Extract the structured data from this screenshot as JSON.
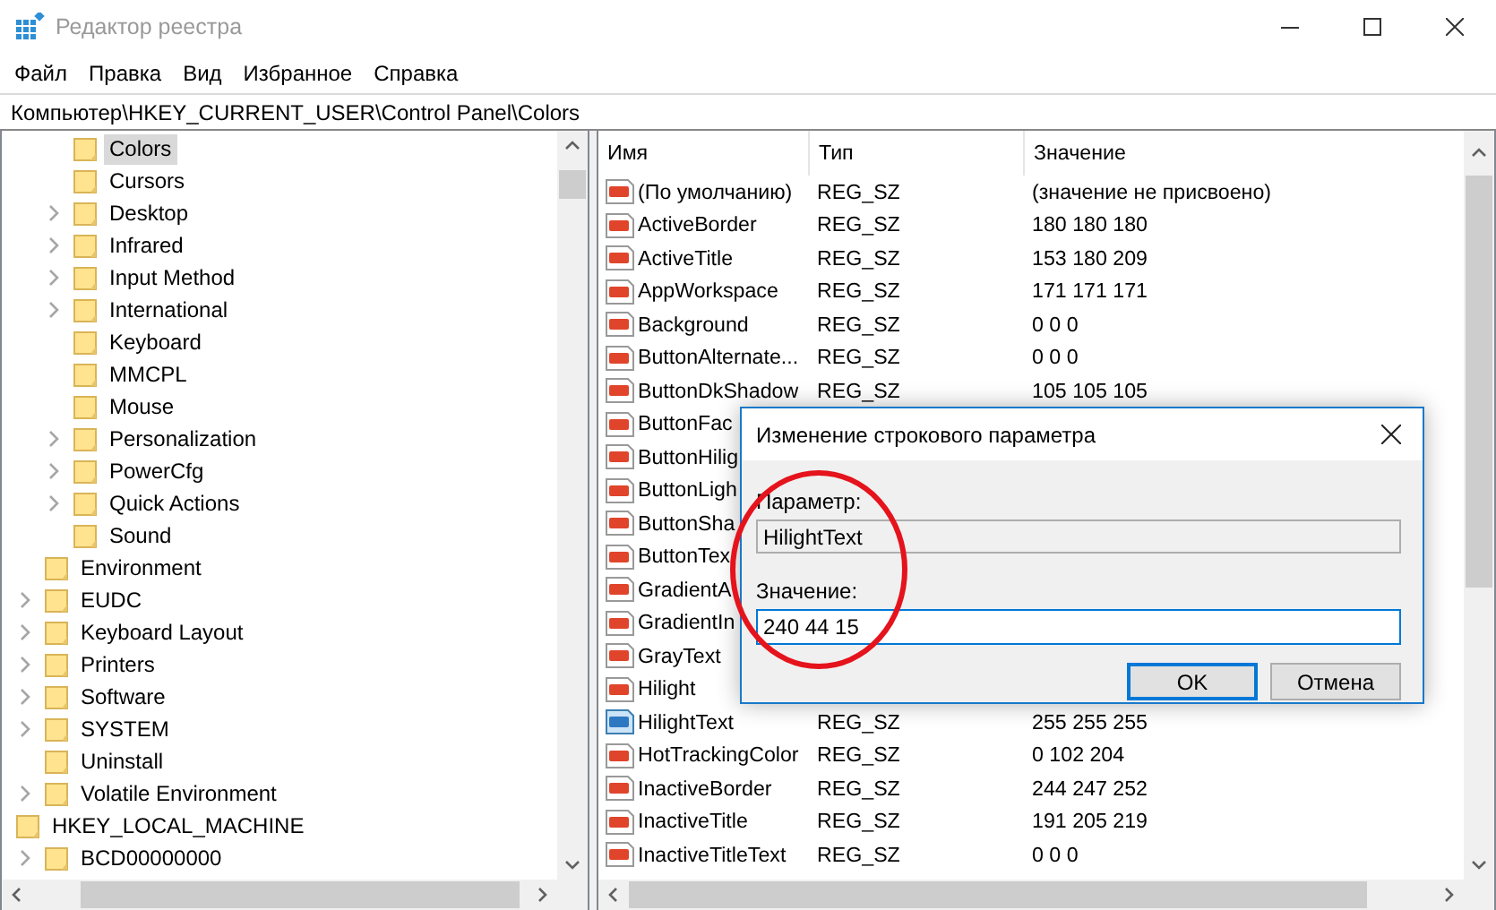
{
  "window": {
    "title": "Редактор реестра"
  },
  "menu": [
    "Файл",
    "Правка",
    "Вид",
    "Избранное",
    "Справка"
  ],
  "address": "Компьютер\\HKEY_CURRENT_USER\\Control Panel\\Colors",
  "tree": [
    {
      "children": [
        {
          "children": [
            {
              "label": "Colors",
              "arrow": false,
              "selected": true
            },
            {
              "label": "Cursors",
              "arrow": false,
              "selected": false
            },
            {
              "label": "Desktop",
              "arrow": true,
              "selected": false
            },
            {
              "label": "Infrared",
              "arrow": true,
              "selected": false
            },
            {
              "label": "Input Method",
              "arrow": true,
              "selected": false
            },
            {
              "label": "International",
              "arrow": true,
              "selected": false
            },
            {
              "label": "Keyboard",
              "arrow": false,
              "selected": false
            },
            {
              "label": "MMCPL",
              "arrow": false,
              "selected": false
            },
            {
              "label": "Mouse",
              "arrow": false,
              "selected": false
            },
            {
              "label": "Personalization",
              "arrow": true,
              "selected": false
            },
            {
              "label": "PowerCfg",
              "arrow": true,
              "selected": false
            },
            {
              "label": "Quick Actions",
              "arrow": true,
              "selected": false
            },
            {
              "label": "Sound",
              "arrow": false,
              "selected": false
            }
          ]
        },
        {
          "label": "Environment",
          "arrow": false,
          "selected": false
        },
        {
          "label": "EUDC",
          "arrow": true,
          "selected": false
        },
        {
          "label": "Keyboard Layout",
          "arrow": true,
          "selected": false
        },
        {
          "label": "Printers",
          "arrow": true,
          "selected": false
        },
        {
          "label": "Software",
          "arrow": true,
          "selected": false
        },
        {
          "label": "SYSTEM",
          "arrow": true,
          "selected": false
        },
        {
          "label": "Uninstall",
          "arrow": false,
          "selected": false
        },
        {
          "label": "Volatile Environment",
          "arrow": true,
          "selected": false
        }
      ]
    },
    {
      "label": "HKEY_LOCAL_MACHINE",
      "arrow": false,
      "selected": false,
      "children": [
        {
          "label": "BCD00000000",
          "arrow": true,
          "selected": false
        }
      ]
    }
  ],
  "values": {
    "columns": [
      "Имя",
      "Тип",
      "Значение"
    ],
    "rows": [
      {
        "name": "(По умолчанию)",
        "type": "REG_SZ",
        "value": "(значение не присвоено)",
        "selected": false
      },
      {
        "name": "ActiveBorder",
        "type": "REG_SZ",
        "value": "180 180 180",
        "selected": false
      },
      {
        "name": "ActiveTitle",
        "type": "REG_SZ",
        "value": "153 180 209",
        "selected": false
      },
      {
        "name": "AppWorkspace",
        "type": "REG_SZ",
        "value": "171 171 171",
        "selected": false
      },
      {
        "name": "Background",
        "type": "REG_SZ",
        "value": "0 0 0",
        "selected": false
      },
      {
        "name": "ButtonAlternate...",
        "type": "REG_SZ",
        "value": "0 0 0",
        "selected": false
      },
      {
        "name": "ButtonDkShadow",
        "type": "REG_SZ",
        "value": "105 105 105",
        "selected": false
      },
      {
        "name": "ButtonFac",
        "selected": false
      },
      {
        "name": "ButtonHilig",
        "selected": false
      },
      {
        "name": "ButtonLigh",
        "selected": false
      },
      {
        "name": "ButtonSha",
        "selected": false
      },
      {
        "name": "ButtonTex",
        "selected": false
      },
      {
        "name": "GradientA",
        "selected": false
      },
      {
        "name": "GradientIn",
        "selected": false
      },
      {
        "name": "GrayText",
        "selected": false
      },
      {
        "name": "Hilight",
        "selected": false
      },
      {
        "name": "HilightText",
        "type": "REG_SZ",
        "value": "255 255 255",
        "selected": true
      },
      {
        "name": "HotTrackingColor",
        "type": "REG_SZ",
        "value": "0 102 204",
        "selected": false
      },
      {
        "name": "InactiveBorder",
        "type": "REG_SZ",
        "value": "244 247 252",
        "selected": false
      },
      {
        "name": "InactiveTitle",
        "type": "REG_SZ",
        "value": "191 205 219",
        "selected": false
      },
      {
        "name": "InactiveTitleText",
        "type": "REG_SZ",
        "value": "0 0 0",
        "selected": false
      }
    ]
  },
  "dialog": {
    "title": "Изменение строкового параметра",
    "name_label": "Параметр:",
    "name_value": "HilightText",
    "value_label": "Значение:",
    "value": "240 44 15",
    "buttons": [
      {
        "label": "OK",
        "default": true
      },
      {
        "label": "Отмена",
        "default": false
      }
    ]
  }
}
